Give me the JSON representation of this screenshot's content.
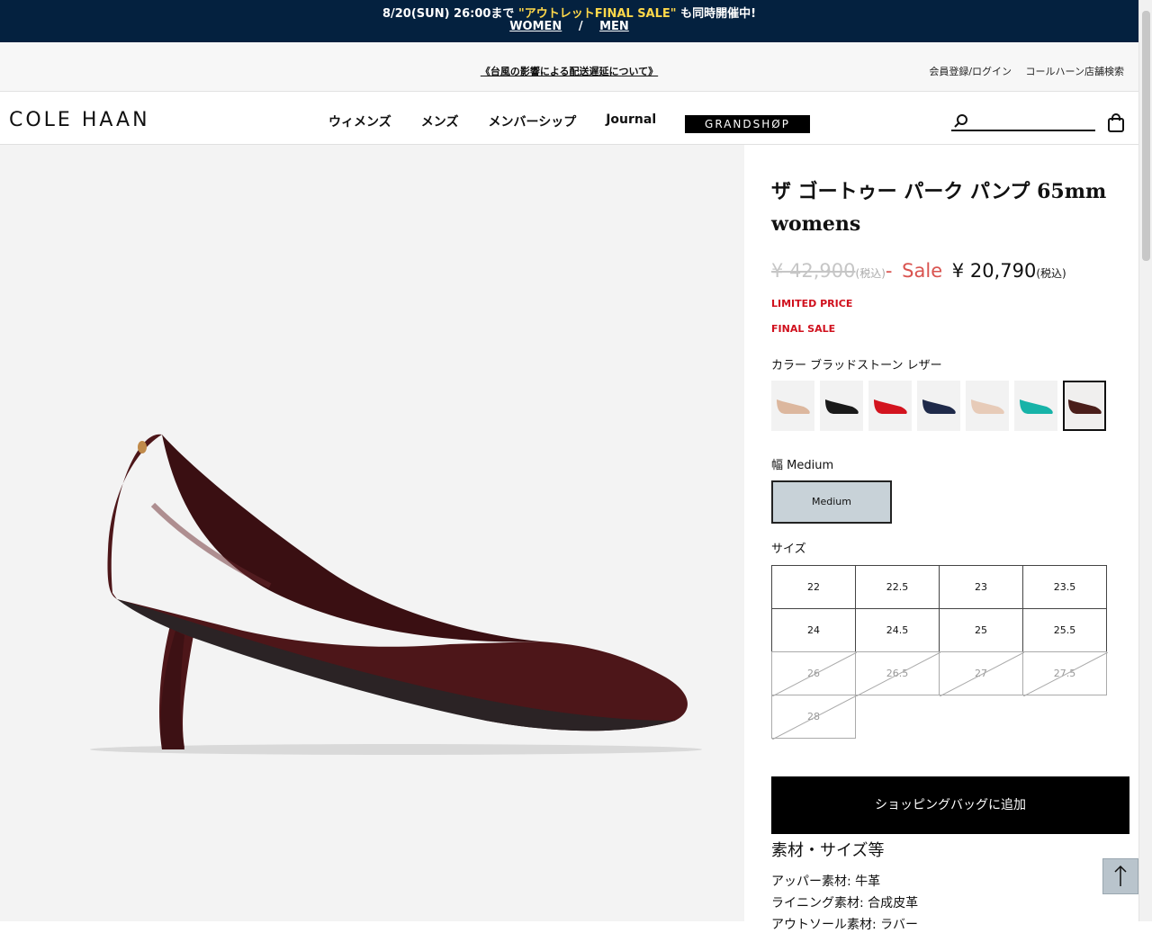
{
  "promo": {
    "line1_prefix": "8/20(SUN) 26:00まで ",
    "line1_highlight": "\"アウトレットFINAL SALE\"",
    "line1_suffix": " も同時開催中!",
    "women": "WOMEN",
    "separator": "/",
    "men": "MEN"
  },
  "utility": {
    "notice": "《台風の影響による配送遅延について》",
    "login": "会員登録/ログイン",
    "store_search": "コールハーン店舗検索"
  },
  "header": {
    "logo": "COLE HAAN",
    "nav": [
      "ウィメンズ",
      "メンズ",
      "メンバーシップ",
      "Journal"
    ],
    "grandshop": "GRANDSHØP",
    "search_placeholder": ""
  },
  "product": {
    "title": "ザ ゴートゥー パーク パンプ 65mm womens",
    "original_price": "¥ 42,900",
    "tax_label": "(税込)",
    "dash": "-",
    "sale_label": "Sale",
    "sale_price": "¥ 20,790",
    "limited": "LIMITED PRICE",
    "final": "FINAL SALE",
    "color_label": "カラー ブラッドストーン レザー",
    "colors": [
      {
        "name": "nude",
        "hex": "#dcb79e"
      },
      {
        "name": "black",
        "hex": "#1a1a1a"
      },
      {
        "name": "red",
        "hex": "#d3141f"
      },
      {
        "name": "navy",
        "hex": "#1f2a4a"
      },
      {
        "name": "blush",
        "hex": "#e7cbb8"
      },
      {
        "name": "teal",
        "hex": "#17b3a8"
      },
      {
        "name": "bloodstone",
        "hex": "#4a1e1a"
      }
    ],
    "width_label": "幅 Medium",
    "width_option": "Medium",
    "size_label": "サイズ",
    "sizes": [
      "22",
      "22.5",
      "23",
      "23.5",
      "24",
      "24.5",
      "25",
      "25.5",
      "26",
      "26.5",
      "27",
      "27.5",
      "28"
    ],
    "add_to_bag": "ショッピングバッグに追加",
    "materials_title": "素材・サイズ等",
    "materials": [
      "アッパー素材: 牛革",
      "ライニング素材: 合成皮革",
      "アウトソール素材: ラバー"
    ]
  },
  "colors": {
    "promo_bg": "#04213f",
    "highlight": "#ffd84a",
    "sale": "#d9534f",
    "tag_red": "#d0101d",
    "shoe": "#4d1619"
  }
}
